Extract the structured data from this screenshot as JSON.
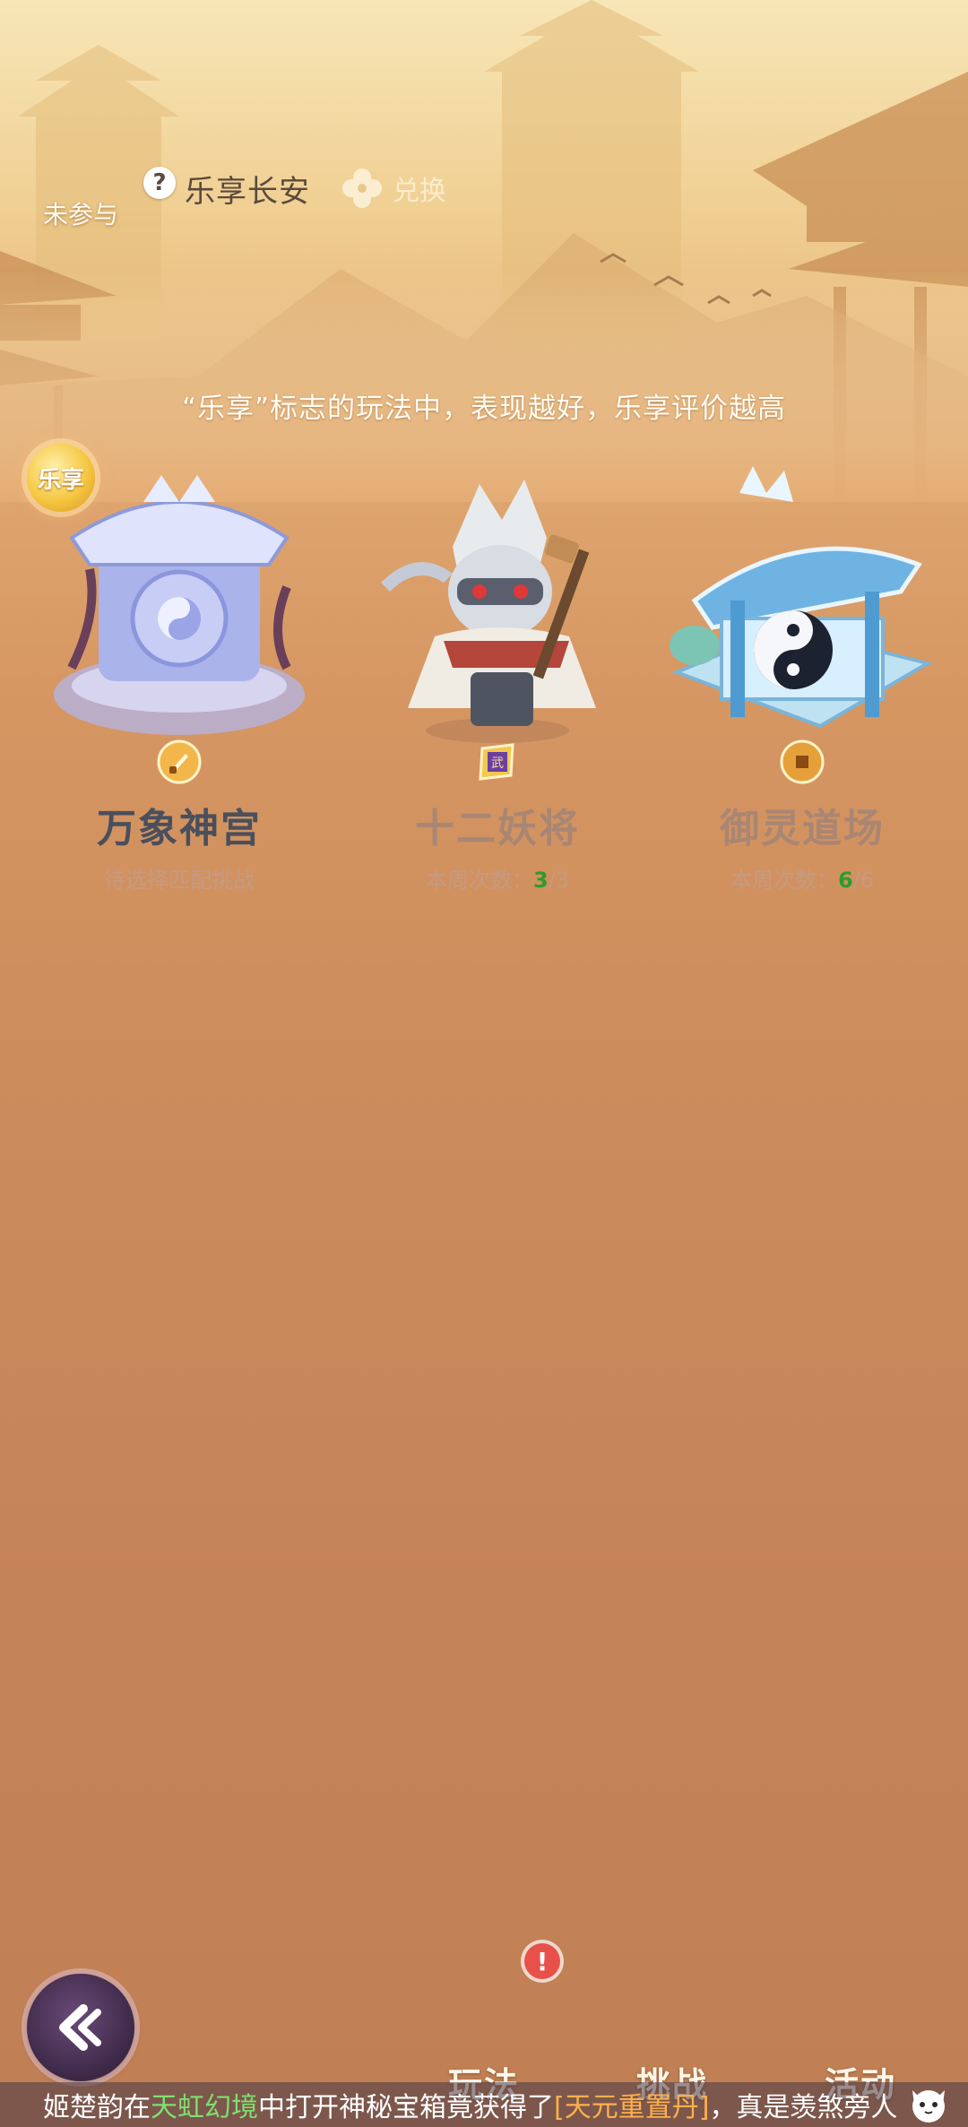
{
  "header": {
    "status_label": "未参与",
    "title": "乐享长安",
    "exchange_label": "兑换",
    "subtitle": "“乐享”标志的玩法中，表现越好，乐享评价越高",
    "badge_label": "乐享"
  },
  "cards": [
    {
      "name": "万象神宫",
      "info": "待选择匹配挑战",
      "name_color": "#4a4f5c",
      "reward_icon": "sword-token-icon"
    },
    {
      "name": "十二妖将",
      "info_prefix": "本周次数：",
      "count": "3",
      "total": "/3",
      "name_color": "#a98673",
      "reward_icon": "purple-token-icon"
    },
    {
      "name": "御灵道场",
      "info_prefix": "本周次数：",
      "count": "6",
      "total": "/6",
      "name_color": "#a98673",
      "reward_icon": "copper-coin-icon"
    }
  ],
  "nav": {
    "tab1": "玩法",
    "tab2": "挑战",
    "tab3": "活动"
  },
  "ticker": {
    "player": "姬楚韵",
    "t1": "在",
    "place": "天虹幻境",
    "t2": "中打开神秘宝箱竟获得了",
    "item": "[天元重置丹]",
    "t3": "，真是羡煞旁人"
  },
  "colors": {
    "accent_gold": "#f5c742",
    "count_green": "#2f9a2f",
    "alert_red": "#e8514a"
  }
}
